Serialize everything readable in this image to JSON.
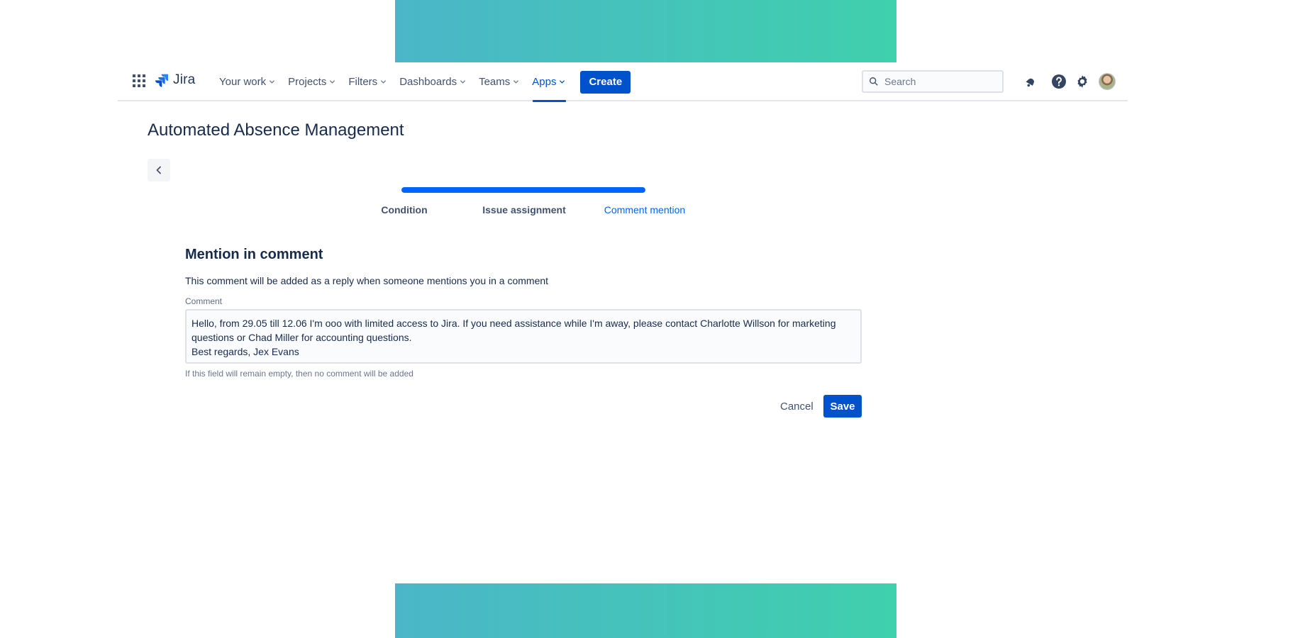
{
  "nav": {
    "logo_text": "Jira",
    "menu": [
      {
        "label": "Your work",
        "active": false
      },
      {
        "label": "Projects",
        "active": false
      },
      {
        "label": "Filters",
        "active": false
      },
      {
        "label": "Dashboards",
        "active": false
      },
      {
        "label": "Teams",
        "active": false
      },
      {
        "label": "Apps",
        "active": true
      }
    ],
    "create_label": "Create",
    "search_placeholder": "Search",
    "icons": [
      "app-switcher-icon",
      "notifications-icon",
      "help-icon",
      "settings-icon",
      "avatar"
    ]
  },
  "page": {
    "title": "Automated Absence Management"
  },
  "wizard": {
    "progress_fraction": 1.0,
    "steps": [
      {
        "label": "Condition",
        "current": false
      },
      {
        "label": "Issue assignment",
        "current": false
      },
      {
        "label": "Comment mention",
        "current": true
      }
    ]
  },
  "form": {
    "section_title": "Mention in comment",
    "description": "This comment will be added as a reply when someone mentions you in a comment",
    "comment_label": "Comment",
    "comment_value": "Hello, from 29.05 till 12.06 I'm ooo with limited access to Jira. If you need assistance while I'm away, please contact Charlotte Willson for marketing questions or Chad Miller for accounting questions.\nBest regards, Jex Evans",
    "helper_text": "If this field will remain empty, then no comment will be added",
    "cancel_label": "Cancel",
    "save_label": "Save"
  },
  "colors": {
    "primary": "#0052CC",
    "progress": "#0065FF",
    "banner_start": "#4bb6c8",
    "banner_end": "#3fd0ad"
  }
}
